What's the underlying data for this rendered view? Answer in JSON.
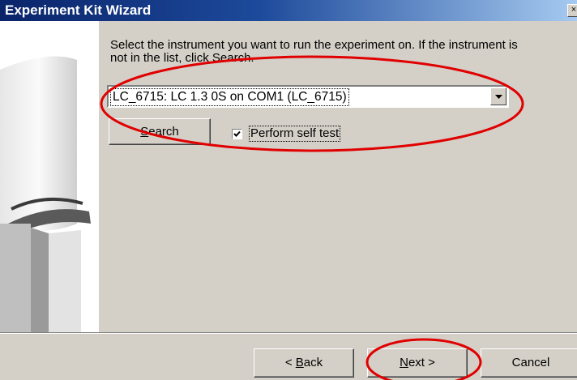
{
  "window": {
    "title": "Experiment Kit Wizard",
    "close_glyph": "×"
  },
  "content": {
    "instruction": "Select the instrument you want to run the experiment on. If the instrument is not in the list, click Search.",
    "instrument_select": {
      "value": "LC_6715: LC 1.3 0S on COM1 (LC_6715)"
    },
    "search_button": {
      "label_underlined": "S",
      "label_rest": "earch"
    },
    "self_test": {
      "checked": true,
      "label": "Perform self test"
    }
  },
  "footer": {
    "back_button": {
      "prefix": "< ",
      "label_underlined": "B",
      "label_rest": "ack"
    },
    "next_button": {
      "label_underlined": "N",
      "label_rest": "ext >"
    },
    "cancel_button": {
      "label": "Cancel"
    }
  },
  "colors": {
    "title_bar": "#0a246a",
    "dialog_bg": "#d4d0c8",
    "annotation": "#e00000"
  },
  "icons": [
    "close-icon",
    "dropdown-arrow-icon",
    "checkmark-icon"
  ]
}
